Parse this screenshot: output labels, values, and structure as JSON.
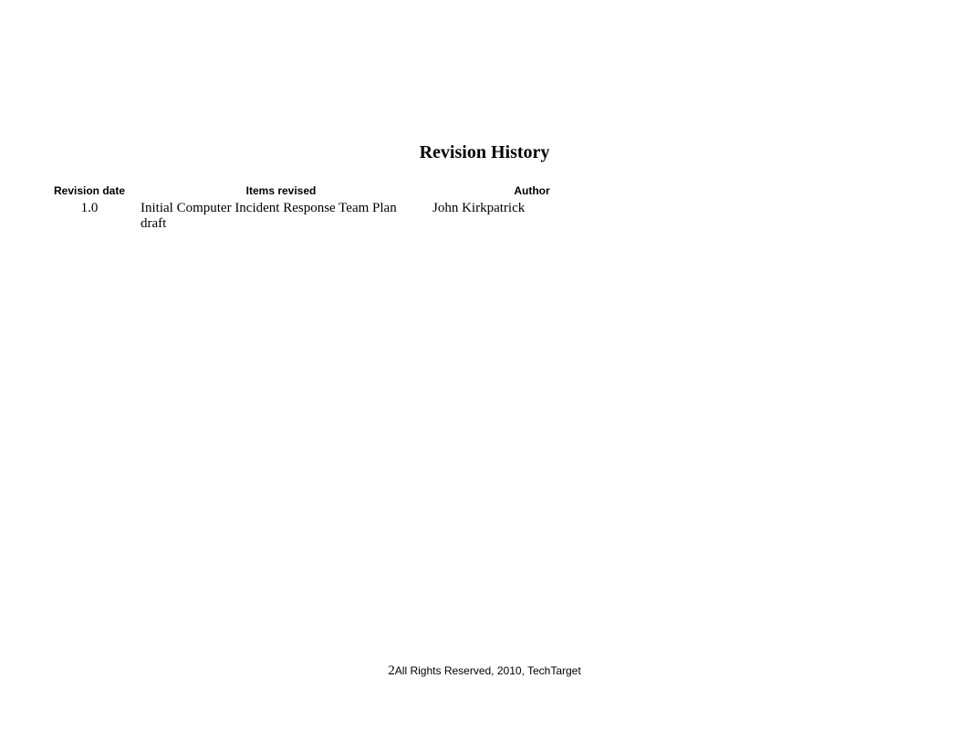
{
  "title": "Revision History",
  "table": {
    "headers": {
      "revision_date": "Revision date",
      "items_revised": "Items revised",
      "author": "Author"
    },
    "rows": [
      {
        "revision_date": "1.0",
        "items_revised": "Initial Computer Incident Response Team Plan draft",
        "author": "John Kirkpatrick"
      }
    ]
  },
  "footer": {
    "page_number": "2",
    "copyright": "All Rights Reserved, 2010, TechTarget"
  }
}
